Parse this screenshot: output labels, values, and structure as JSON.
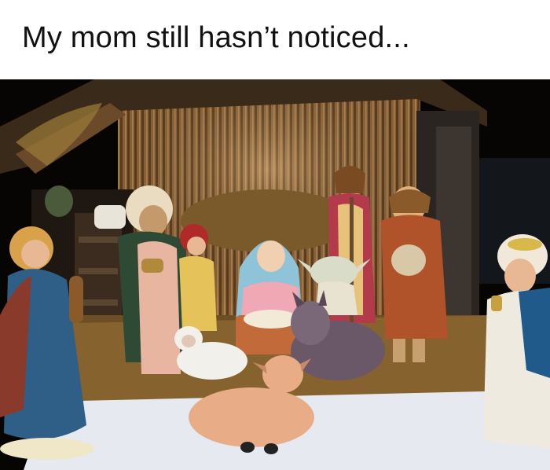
{
  "caption": "My mom still hasn’t noticed...",
  "photo": {
    "subject": "nativity-scene-photo",
    "figures": [
      "angel",
      "wise-man",
      "shepherd-child",
      "mary",
      "joseph",
      "shepherd",
      "yoda",
      "donkey",
      "lamb",
      "calf",
      "baby-jesus",
      "wise-man-right"
    ]
  },
  "colors": {
    "background": "#ffffff",
    "caption_text": "#111111",
    "night": "#050403",
    "stable_wood": "#8a6238",
    "straw": "#a47a3c",
    "snow": "#e8ecf2"
  }
}
